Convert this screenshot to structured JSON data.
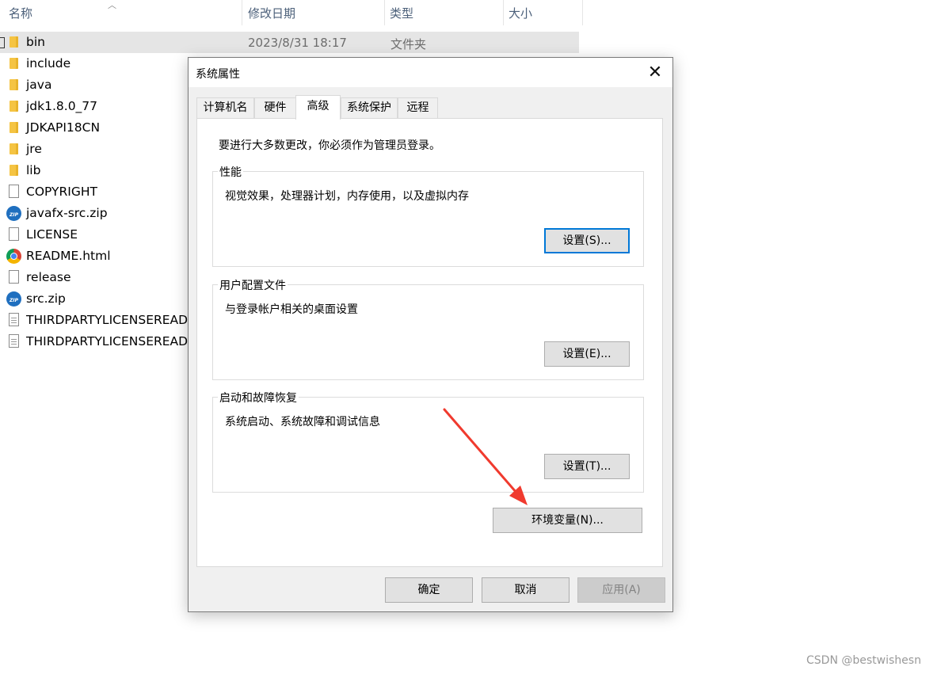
{
  "explorer": {
    "columns": {
      "name": "名称",
      "date": "修改日期",
      "type": "类型",
      "size": "大小"
    },
    "files": [
      {
        "name": "bin",
        "date": "2023/8/31 18:17",
        "type": "文件夹",
        "icon": "folder-icon",
        "selected": true
      },
      {
        "name": "include",
        "icon": "folder-icon"
      },
      {
        "name": "java",
        "icon": "folder-icon"
      },
      {
        "name": "jdk1.8.0_77",
        "icon": "folder-icon"
      },
      {
        "name": "JDKAPI18CN",
        "icon": "folder-icon"
      },
      {
        "name": "jre",
        "icon": "folder-icon"
      },
      {
        "name": "lib",
        "icon": "folder-icon"
      },
      {
        "name": "COPYRIGHT",
        "icon": "file-icon"
      },
      {
        "name": "javafx-src.zip",
        "icon": "zip-icon"
      },
      {
        "name": "LICENSE",
        "icon": "file-icon"
      },
      {
        "name": "README.html",
        "icon": "chrome-icon"
      },
      {
        "name": "release",
        "icon": "file-icon"
      },
      {
        "name": "src.zip",
        "icon": "zip-icon"
      },
      {
        "name": "THIRDPARTYLICENSEREADM",
        "icon": "text-file-icon"
      },
      {
        "name": "THIRDPARTYLICENSEREADM",
        "icon": "text-file-icon"
      }
    ]
  },
  "dialog": {
    "title": "系统属性",
    "close_symbol": "✕",
    "tabs": [
      {
        "label": "计算机名"
      },
      {
        "label": "硬件"
      },
      {
        "label": "高级",
        "active": true
      },
      {
        "label": "系统保护"
      },
      {
        "label": "远程"
      }
    ],
    "admin_note": "要进行大多数更改，你必须作为管理员登录。",
    "groups": [
      {
        "title": "性能",
        "desc": "视觉效果，处理器计划，内存使用，以及虚拟内存",
        "button": "设置(S)..."
      },
      {
        "title": "用户配置文件",
        "desc": "与登录帐户相关的桌面设置",
        "button": "设置(E)..."
      },
      {
        "title": "启动和故障恢复",
        "desc": "系统启动、系统故障和调试信息",
        "button": "设置(T)..."
      }
    ],
    "env_button": "环境变量(N)...",
    "footer": {
      "ok": "确定",
      "cancel": "取消",
      "apply": "应用(A)"
    }
  },
  "colors": {
    "arrow": "#f03a2e",
    "focus": "#0078d7"
  },
  "watermark": "CSDN @bestwishesn"
}
